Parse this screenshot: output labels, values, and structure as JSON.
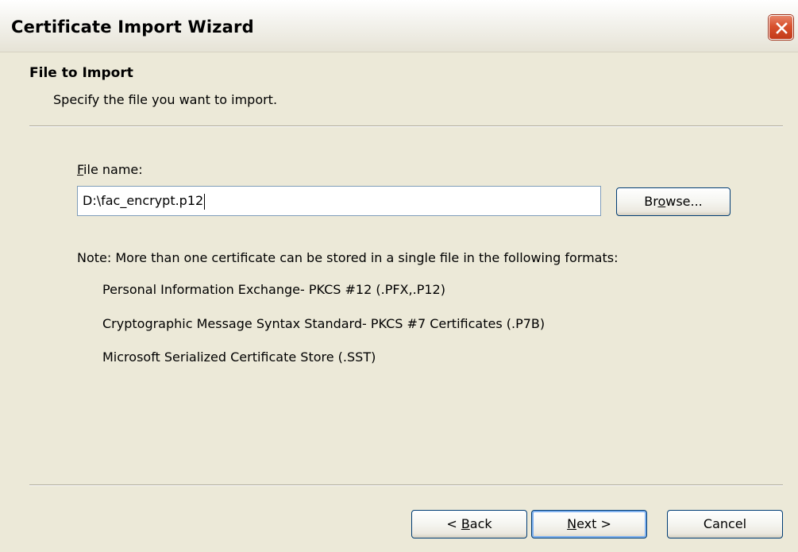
{
  "window": {
    "title": "Certificate Import Wizard"
  },
  "header": {
    "title": "File to Import",
    "subtitle": "Specify the file you want to import."
  },
  "file_field": {
    "label_prefix": "",
    "label_mnemonic": "F",
    "label_rest": "ile name:",
    "value": "D:\\fac_encrypt.p12"
  },
  "browse_button": {
    "pre": "Br",
    "mnemonic": "o",
    "post": "wse..."
  },
  "note": {
    "text": "Note:  More than one certificate can be stored in a single file in the following formats:",
    "formats": [
      "Personal Information Exchange- PKCS #12 (.PFX,.P12)",
      "Cryptographic Message Syntax Standard- PKCS #7 Certificates (.P7B)",
      "Microsoft Serialized Certificate Store (.SST)"
    ]
  },
  "footer": {
    "back": {
      "pre": "< ",
      "mnemonic": "B",
      "post": "ack"
    },
    "next": {
      "pre": "",
      "mnemonic": "N",
      "post": "ext >"
    },
    "cancel": "Cancel"
  },
  "colors": {
    "dialog_bg": "#ece9d8",
    "button_border": "#003c74",
    "input_border": "#7f9db9",
    "close_button": "#d8512d"
  },
  "icons": {
    "close": "close-icon"
  }
}
